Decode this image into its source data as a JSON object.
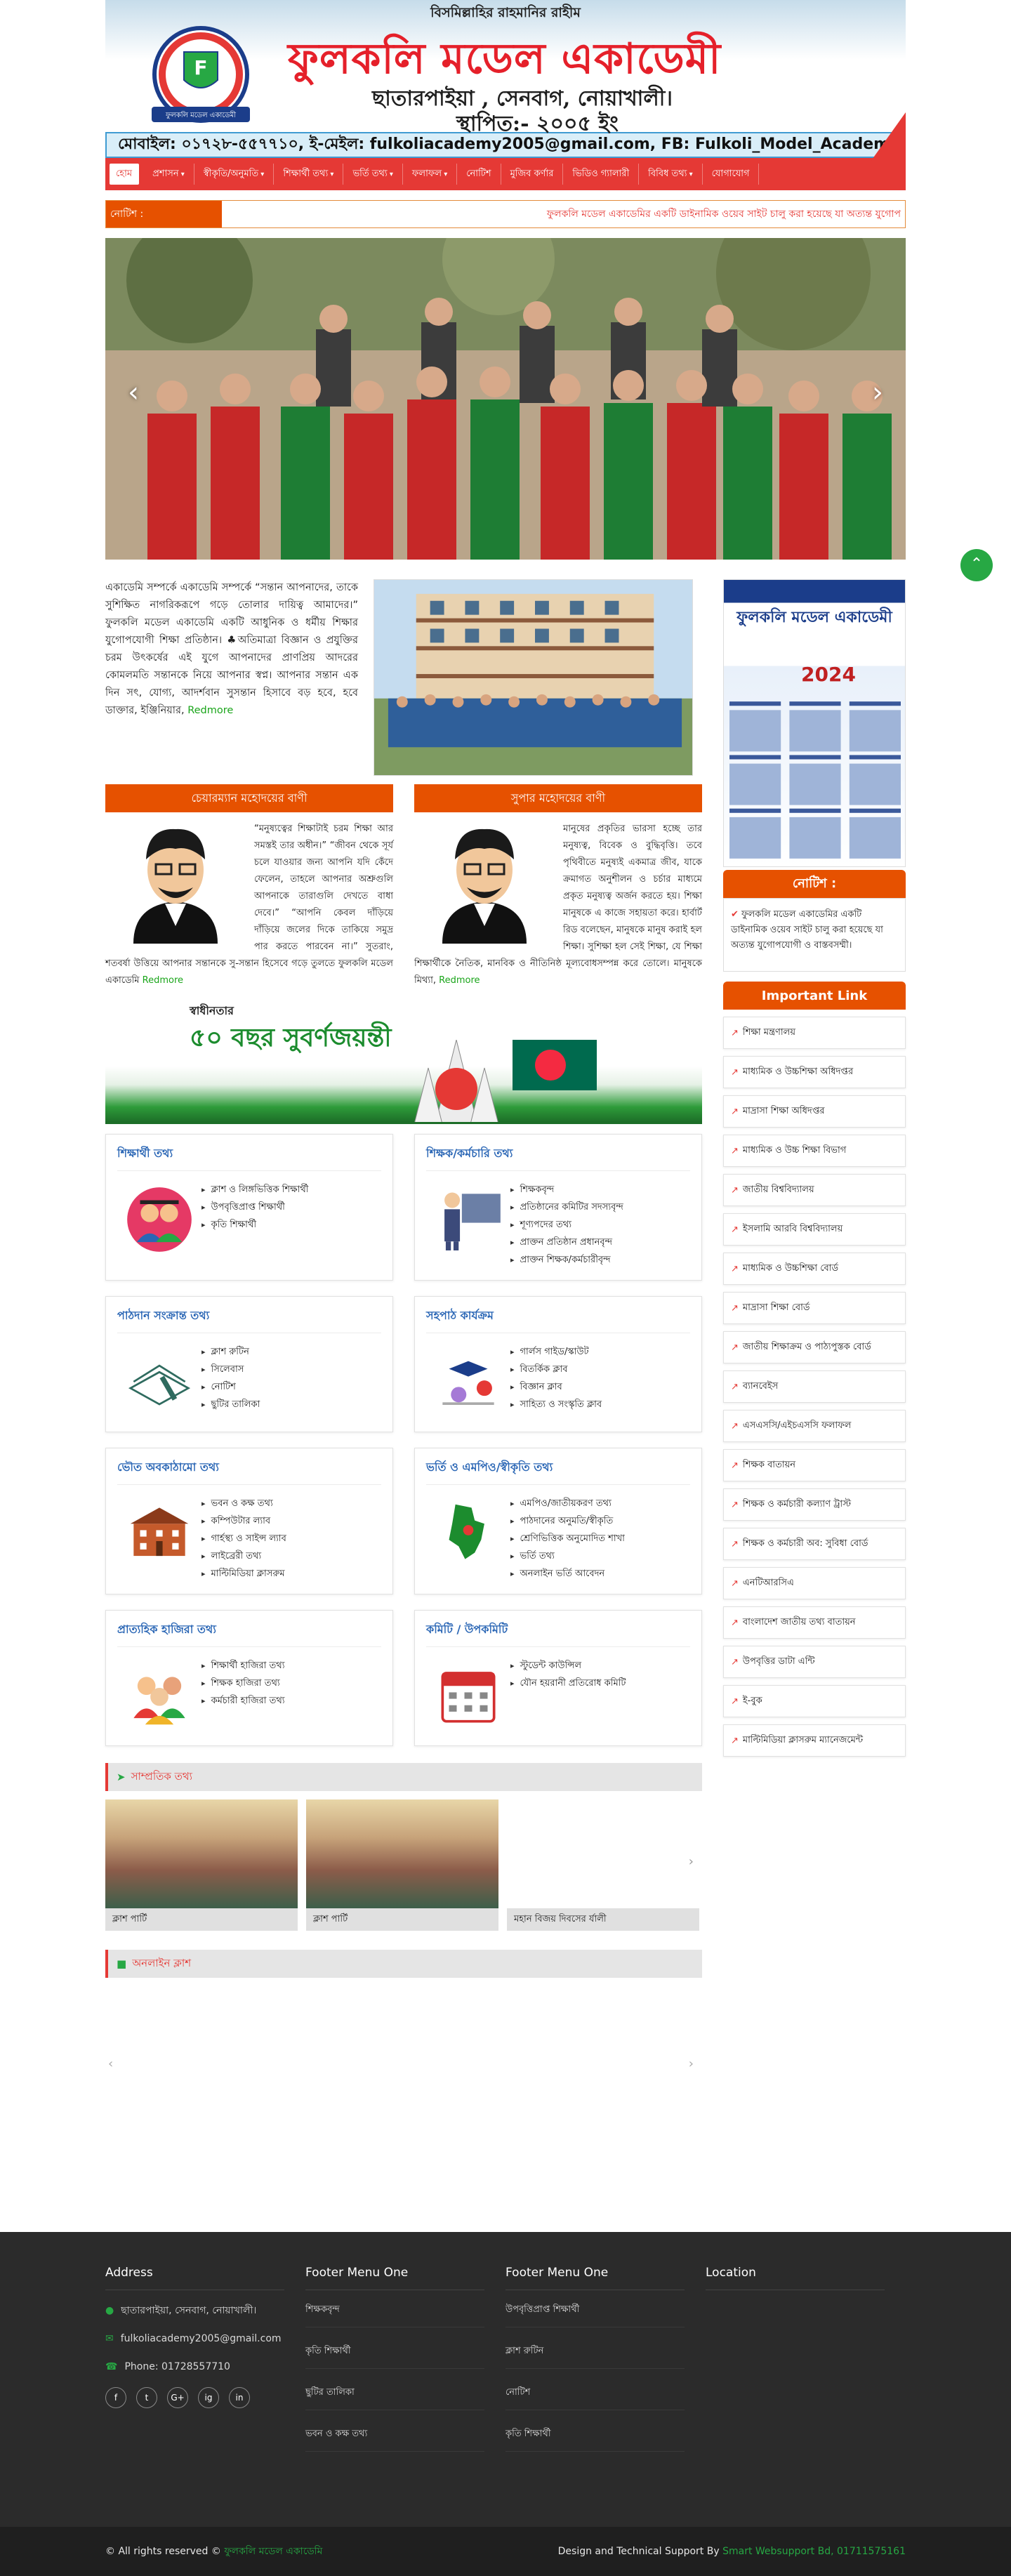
{
  "header": {
    "bismillah": "বিসমিল্লাহির রাহমানির রাহীম",
    "title": "ফুলকলি মডেল একাডেমী",
    "location": "ছাতারপাইয়া , সেনবাগ, নোয়াখালী।",
    "established": "স্থাপিত:- ২০০৫ ইং",
    "logo_text": "Fulkoli Model Academy",
    "logo_sub": "ফুলকলি মডেল একাডেমী"
  },
  "contact": "মোবাইল: ০১৭২৮-৫৫৭৭১০, ই-মেইল: fulkoliacademy2005@gmail.com, FB: Fulkoli_Model_Academy",
  "nav": [
    {
      "label": "হোম",
      "dd": false
    },
    {
      "label": "প্রশাসন",
      "dd": true
    },
    {
      "label": "স্বীকৃতি/অনুমতি",
      "dd": true
    },
    {
      "label": "শিক্ষার্থী তথ্য",
      "dd": true
    },
    {
      "label": "ভর্তি তথ্য",
      "dd": true
    },
    {
      "label": "ফলাফল",
      "dd": true
    },
    {
      "label": "নোটিশ",
      "dd": false
    },
    {
      "label": "মুজিব কর্ণার",
      "dd": false
    },
    {
      "label": "ভিডিও গ্যালারী",
      "dd": false
    },
    {
      "label": "বিবিধ তথ্য",
      "dd": true
    },
    {
      "label": "যোগাযোগ",
      "dd": false
    }
  ],
  "notice": {
    "label": "নোটিশ :",
    "text": "ফুলকলি মডেল একাডেমির একটি ডাইনামিক ওয়েব সাইট চালু করা হয়েছে যা অত্যন্ত যুগোপ"
  },
  "slider": {
    "prev": "‹",
    "next": "›"
  },
  "about": {
    "text": "একাডেমি সম্পর্কে একাডেমি সম্পর্কে “সন্তান আপনাদের, তাকে সুশিক্ষিত নাগরিকরূপে গড়ে তোলার দায়িত্ব আমাদের।” ফুলকলি মডেল একাডেমি একটি আধুনিক ও ধর্মীয় শিক্ষার যুগোপযোগী শিক্ষা প্রতিষ্ঠান। ♣অতিমাত্রা বিজ্ঞান ও প্রযুক্তির চরম উৎকর্ষের এই যুগে আপনাদের প্রাণপ্রিয় আদরের কোমলমতি সন্তানকে নিয়ে আপনার স্বপ্ন। আপনার সন্তান এক দিন সৎ, যোগ্য, আদর্শবান সুসন্তান হিসাবে বড় হবে, হবে ডাক্তার, ইঞ্জিনিয়ার, ",
    "more": "Redmore"
  },
  "messages": [
    {
      "title": "চেয়ারম্যান মহোদয়ের বাণী",
      "text": "“মনুষ্যত্বের শিক্ষাটাই চরম শিক্ষা আর সমস্তই তার অধীন।” “জীবন থেকে সূর্য চলে যাওয়ার জন্য আপনি যদি কেঁদে ফেলেন, তাহলে আপনার অশ্রুগুলি আপনাকে তারাগুলি দেখতে বাধা দেবে।” “আপনি কেবল দাঁড়িয়ে দাঁড়িয়ে জলের দিকে তাকিয়ে সমুদ্র পার করতে পারবেন না।” সুতরাং, শতবর্ষা উত্তিয়ে আপনার সন্তানকে সু-সন্তান হিসেবে গড়ে তুলতে ফুলকলি মডেল একাডেমি ",
      "more": "Redmore"
    },
    {
      "title": "সুপার মহোদয়ের বাণী",
      "text": "মানুষের প্রকৃতির ভারসা হচ্ছে তার মনুষ্যত্ব, বিবেক ও বুদ্ধিবৃত্তি। তবে পৃথিবীতে মনুষ্যই একমাত্র জীব, যাকে ক্রমাগত অনুশীলন ও চর্চার মাধ্যমে প্রকৃত মনুষ্যত্ব অর্জন করতে হয়। শিক্ষা মানুষকে এ কাজে সহায়তা করে। হার্বার্ট রিড বলেছেন, মানুষকে মানুষ করাই হল শিক্ষা। সুশিক্ষা হল সেই শিক্ষা, যে শিক্ষা শিক্ষার্থীকে নৈতিক, মানবিক ও নীতিনিষ্ঠ মূল্যবোধসম্পন্ন করে তোলে। মানুষকে মিথ্যা, ",
      "more": "Redmore"
    }
  ],
  "banner": {
    "top": "স্বাধীনতার",
    "text": "৫০ বছর সুবর্ণজয়ন্তী"
  },
  "cards": [
    {
      "title": "শিক্ষার্থী তথ্য",
      "icon": "graduates-icon",
      "items": [
        "ক্লাশ ও লিঙ্গভিত্তিক শিক্ষার্থী",
        "উপবৃত্তিপ্রাপ্ত শিক্ষার্থী",
        "কৃতি শিক্ষার্থী"
      ]
    },
    {
      "title": "শিক্ষক/কর্মচারি তথ্য",
      "icon": "teacher-icon",
      "items": [
        "শিক্ষকবৃন্দ",
        "প্রতিষ্ঠানের কমিটির সদস্যবৃন্দ",
        "শূণ্যপদের তথ্য",
        "প্রাক্তন প্রতিষ্ঠান প্রধানবৃন্দ",
        "প্রাক্তন শিক্ষক/কর্মচারীবৃন্দ"
      ]
    },
    {
      "title": "পাঠদান সংক্রান্ত তথ্য",
      "icon": "book-icon",
      "items": [
        "ক্লাশ রুটিন",
        "সিলেবাস",
        "নোটিশ",
        "ছুটির তালিকা"
      ]
    },
    {
      "title": "সহপাঠ কার্যক্রম",
      "icon": "sports-icon",
      "items": [
        "গার্লস গাইড/স্কাউট",
        "বিতর্কিক ক্লাব",
        "বিজ্ঞান ক্লাব",
        "সাহিত্য ও সংস্কৃতি ক্লাব"
      ]
    },
    {
      "title": "ভৌত অবকাঠামো তথ্য",
      "icon": "building-icon",
      "items": [
        "ভবন ও কক্ষ তথ্য",
        "কম্পিউটার ল্যাব",
        "গার্হস্থ্য ও সাইন্স ল্যাব",
        "লাইব্রেরী তথ্য",
        "মাল্টিমিডিয়া ক্লাসরুম"
      ]
    },
    {
      "title": "ভর্তি ও এমপিও/স্বীকৃতি তথ্য",
      "icon": "map-icon",
      "items": [
        "এমপিও/জাতীয়করণ তথ্য",
        "পাঠদানের অনুমতি/স্বীকৃতি",
        "শ্রেণিভিত্তিক অনুমোদিত শাখা",
        "ভর্তি তথ্য",
        "অনলাইন ভর্তি আবেদন"
      ]
    },
    {
      "title": "প্রাত্যহিক হাজিরা তথ্য",
      "icon": "people-icon",
      "items": [
        "শিক্ষার্থী হাজিরা তথ্য",
        "শিক্ষক হাজিরা তথ্য",
        "কর্মচারী হাজিরা তথ্য"
      ]
    },
    {
      "title": "কমিটি / উপকমিটি",
      "icon": "calendar-icon",
      "items": [
        "স্টুডেন্ট কাউন্সিল",
        "যৌন হয়রানী প্রতিরোধ কমিটি"
      ]
    }
  ],
  "recent": {
    "title": "সাম্প্রতিক তথ্য",
    "items": [
      "ক্লাশ পার্টি",
      "ক্লাশ পার্টি",
      "মহান বিজয় দিবসের র্যালী"
    ]
  },
  "online": {
    "title": "অনলাইন ক্লাশ"
  },
  "sidebar": {
    "calendar_title": "ফুলকলি মডেল একাডেমী",
    "calendar_year": "2024",
    "notice_title": "নোটিশ :",
    "notice_text": "ফুলকলি মডেল একাডেমির একটি ডাইনামিক ওয়েব সাইট চালু করা হয়েছে যা অত্যন্ত যুগোপযোগী ও বাস্তবসম্মী।",
    "important_title": "Important Link",
    "links": [
      "শিক্ষা মন্ত্রণালয়",
      "মাধ্যমিক ও উচ্চশিক্ষা অধিদপ্তর",
      "মাদ্রাসা শিক্ষা অধিদপ্তর",
      "মাধ্যমিক ও উচ্চ শিক্ষা বিভাগ",
      "জাতীয় বিশ্ববিদ্যালয়",
      "ইসলামি আরবি বিশ্ববিদ্যালয়",
      "মাধ্যমিক ও উচ্চশিক্ষা বোর্ড",
      "মাদ্রাসা শিক্ষা বোর্ড",
      "জাতীয় শিক্ষাক্রম ও পাঠ্যপুস্তক বোর্ড",
      "ব্যানবেইস",
      "এসএসসি/এইচএসসি ফলাফল",
      "শিক্ষক বাতায়ন",
      "শিক্ষক ও কর্মচারী কল্যাণ ট্রাস্ট",
      "শিক্ষক ও কর্মচারী অব: সুবিধা বোর্ড",
      "এনটিআরসিএ",
      "বাংলাদেশ জাতীয় তথ্য বাতায়ন",
      "উপবৃত্তির ডাটা এন্টি",
      "ই-বুক",
      "মাল্টিমিডিয়া ক্লাসরুম ম্যানেজমেন্ট"
    ]
  },
  "footer": {
    "address_title": "Address",
    "address": "ছাতারপাইয়া, সেনবাগ, নোয়াখালী।",
    "email": "fulkoliacademy2005@gmail.com",
    "phone": "Phone: 01728557710",
    "menu1_title": "Footer Menu One",
    "menu1": [
      "শিক্ষকবৃন্দ",
      "কৃতি শিক্ষার্থী",
      "ছুটির তালিকা",
      "ভবন ও কক্ষ তথ্য"
    ],
    "menu2_title": "Footer Menu One",
    "menu2": [
      "উপবৃত্তিপ্রাপ্ত শিক্ষার্থী",
      "ক্লাশ রুটিন",
      "নোটিশ",
      "কৃতি শিক্ষার্থী"
    ],
    "location_title": "Location",
    "social": [
      "f",
      "t",
      "G+",
      "ig",
      "in"
    ],
    "copyright": "© All rights reserved © ",
    "copyright_name": "ফুলকলি মডেল একাডেমি",
    "support": "Design and Technical Support By ",
    "support_name": "Smart Websupport Bd, 01711575161"
  }
}
